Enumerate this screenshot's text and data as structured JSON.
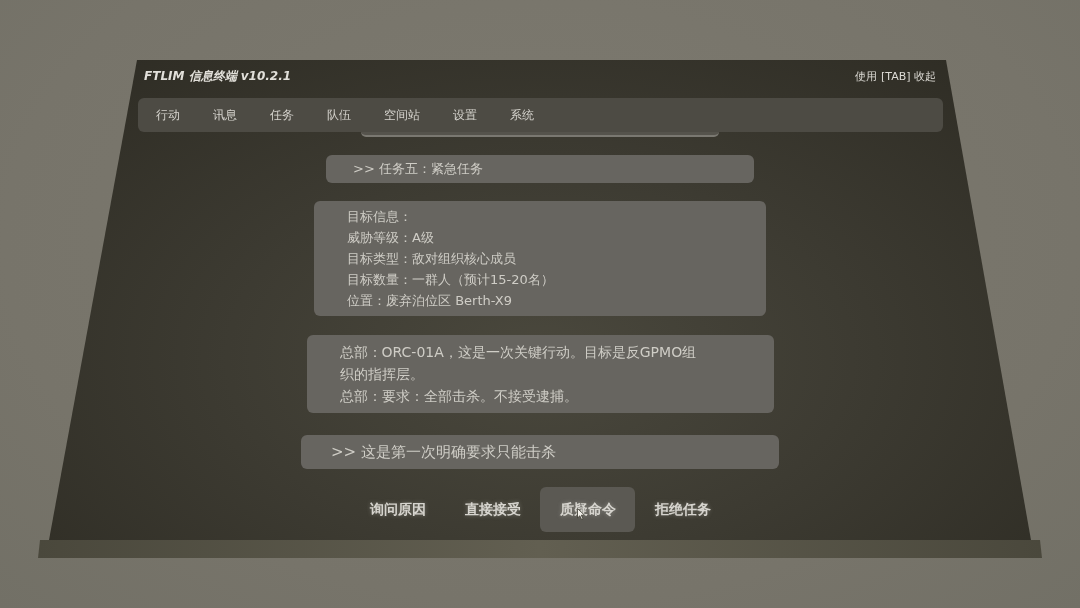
{
  "window": {
    "title": "FTLIM 信息终端 v10.2.1",
    "hint": "使用 [TAB] 收起"
  },
  "menu": [
    "行动",
    "讯息",
    "任务",
    "队伍",
    "空间站",
    "设置",
    "系统"
  ],
  "messages": [
    {
      "kind": "prompt",
      "lines": [
        ">> 任务五：紧急任务"
      ]
    },
    {
      "kind": "info",
      "lines": [
        "目标信息：",
        "威胁等级：A级",
        "目标类型：敌对组织核心成员",
        "目标数量：一群人（预计15-20名）",
        "位置：废弃泊位区 Berth-X9"
      ]
    },
    {
      "kind": "dialogue",
      "lines": [
        "总部：ORC-01A，这是一次关键行动。目标是反GPMO组织的指挥层。",
        "总部：要求：全部击杀。不接受逮捕。"
      ]
    },
    {
      "kind": "prompt",
      "lines": [
        ">> 这是第一次明确要求只能击杀"
      ]
    }
  ],
  "choices": [
    {
      "label": "询问原因",
      "selected": false
    },
    {
      "label": "直接接受",
      "selected": false
    },
    {
      "label": "质疑命令",
      "selected": true
    },
    {
      "label": "拒绝任务",
      "selected": false
    }
  ]
}
